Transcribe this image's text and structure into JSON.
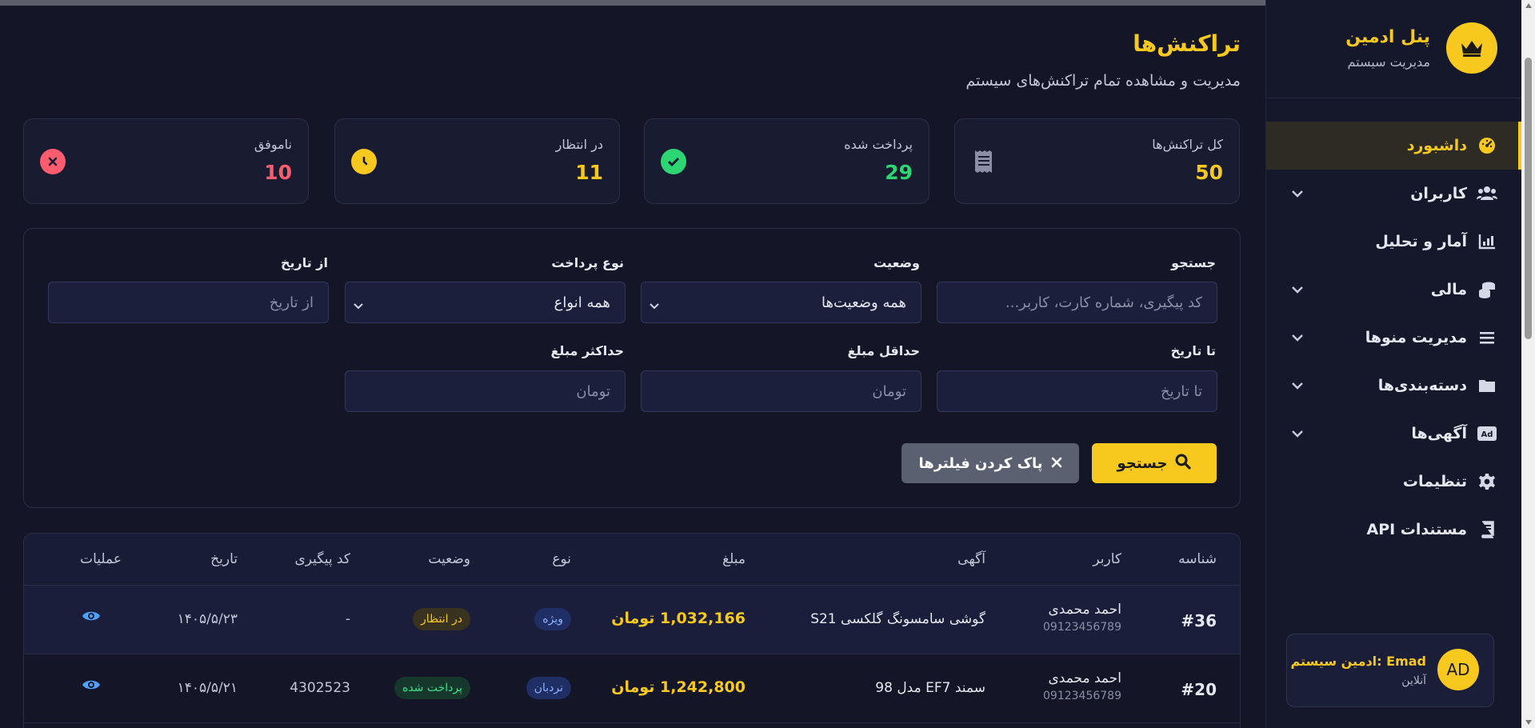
{
  "colors": {
    "accent": "#f7c81e",
    "success": "#2ed573",
    "danger": "#ff5c70",
    "bg": "#141628"
  },
  "sidebar": {
    "brand_title": "پنل ادمین",
    "brand_subtitle": "مدیریت سیستم",
    "brand_icon": "crown-icon",
    "items": [
      {
        "label": "داشبورد",
        "icon": "dashboard-gauge-icon",
        "active": true,
        "has_submenu": false
      },
      {
        "label": "کاربران",
        "icon": "users-icon",
        "active": false,
        "has_submenu": true
      },
      {
        "label": "آمار و تحلیل",
        "icon": "chart-icon",
        "active": false,
        "has_submenu": false
      },
      {
        "label": "مالی",
        "icon": "coins-icon",
        "active": false,
        "has_submenu": true
      },
      {
        "label": "مدیریت منوها",
        "icon": "menu-bars-icon",
        "active": false,
        "has_submenu": true
      },
      {
        "label": "دسته‌بندی‌ها",
        "icon": "folder-icon",
        "active": false,
        "has_submenu": true
      },
      {
        "label": "آگهی‌ها",
        "icon": "ad-icon",
        "active": false,
        "has_submenu": true
      },
      {
        "label": "تنظیمات",
        "icon": "gear-icon",
        "active": false,
        "has_submenu": false
      },
      {
        "label": "مستندات API",
        "icon": "book-icon",
        "active": false,
        "has_submenu": false
      }
    ],
    "user": {
      "initials": "AD",
      "name": "ادمین سیستم: Emad",
      "status": "آنلاین"
    }
  },
  "header": {
    "title": "تراکنش‌ها",
    "subtitle": "مدیریت و مشاهده تمام تراکنش‌های سیستم"
  },
  "stats": [
    {
      "label": "کل تراکنش‌ها",
      "value": "50",
      "icon": "receipt-icon",
      "color": "#f7c81e"
    },
    {
      "label": "پرداخت شده",
      "value": "29",
      "icon": "check-circle-icon",
      "color": "#2ed573"
    },
    {
      "label": "در انتظار",
      "value": "11",
      "icon": "clock-icon",
      "color": "#f7c81e"
    },
    {
      "label": "ناموفق",
      "value": "10",
      "icon": "x-circle-icon",
      "color": "#ff5c70"
    }
  ],
  "filters": {
    "search": {
      "label": "جستجو",
      "placeholder": "کد پیگیری، شماره کارت، کاربر..."
    },
    "status": {
      "label": "وضعیت",
      "value": "همه وضعیت‌ها"
    },
    "payment_type": {
      "label": "نوع پرداخت",
      "value": "همه انواع"
    },
    "from_date": {
      "label": "از تاریخ",
      "placeholder": "از تاریخ"
    },
    "to_date": {
      "label": "تا تاریخ",
      "placeholder": "تا تاریخ"
    },
    "min_amount": {
      "label": "حداقل مبلغ",
      "placeholder": "تومان"
    },
    "max_amount": {
      "label": "حداکثر مبلغ",
      "placeholder": "تومان"
    },
    "search_button": "جستجو",
    "clear_button": "پاک کردن فیلترها"
  },
  "table": {
    "headers": [
      "شناسه",
      "کاربر",
      "آگهی",
      "مبلغ",
      "نوع",
      "وضعیت",
      "کد پیگیری",
      "تاریخ",
      "عملیات"
    ],
    "rows": [
      {
        "id": "#36",
        "user_name": "احمد محمدی",
        "user_phone": "09123456789",
        "ad": "گوشی سامسونگ گلکسی S21",
        "amount": "1,032,166 تومان",
        "type": "ویژه",
        "status": "در انتظار",
        "status_kind": "pending",
        "tracking": "-",
        "date": "۱۴۰۵/۵/۲۳",
        "action_icon": "eye-icon"
      },
      {
        "id": "#20",
        "user_name": "احمد محمدی",
        "user_phone": "09123456789",
        "ad": "سمند EF7 مدل 98",
        "amount": "1,242,800 تومان",
        "type": "نردبان",
        "status": "پرداخت شده",
        "status_kind": "paid",
        "tracking": "4302523",
        "date": "۱۴۰۵/۵/۲۱",
        "action_icon": "eye-icon"
      }
    ]
  }
}
